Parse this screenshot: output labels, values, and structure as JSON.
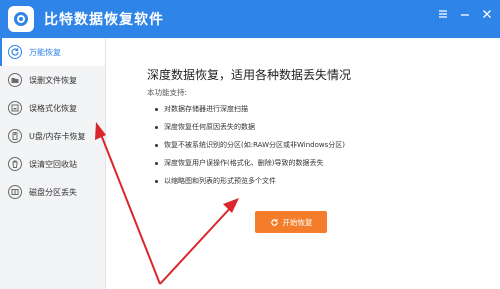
{
  "app": {
    "title": "比特数据恢复软件",
    "logo_icon": "disk-recovery-logo",
    "brand_color": "#2f84e8"
  },
  "window_controls": [
    {
      "name": "menu-icon"
    },
    {
      "name": "minimize-icon"
    },
    {
      "name": "close-icon"
    }
  ],
  "sidebar": {
    "items": [
      {
        "label": "万能恢复",
        "icon": "refresh-icon",
        "active": true
      },
      {
        "label": "误删文件恢复",
        "icon": "folder-icon",
        "active": false
      },
      {
        "label": "误格式化恢复",
        "icon": "disk-icon",
        "active": false
      },
      {
        "label": "U盘/内存卡恢复",
        "icon": "usb-icon",
        "active": false
      },
      {
        "label": "误清空回收站",
        "icon": "recycle-bin-icon",
        "active": false
      },
      {
        "label": "磁盘分区丢失",
        "icon": "partition-icon",
        "active": false
      }
    ]
  },
  "main": {
    "heading": "深度数据恢复，适用各种数据丢失情况",
    "subheading": "本功能支持:",
    "features": [
      "对数据存储器进行深度扫描",
      "深度恢复任何原因丢失的数据",
      "恢复不被系统识别的分区(如:RAW分区或非Windows分区)",
      "深度恢复用户误操作(格式化、删除)导致的数据丢失",
      "以缩略图和列表的形式预览多个文件"
    ],
    "start_button": "开始恢复",
    "start_button_color": "#f47d2b"
  },
  "annotation": {
    "arrow_color": "#d9262b"
  }
}
